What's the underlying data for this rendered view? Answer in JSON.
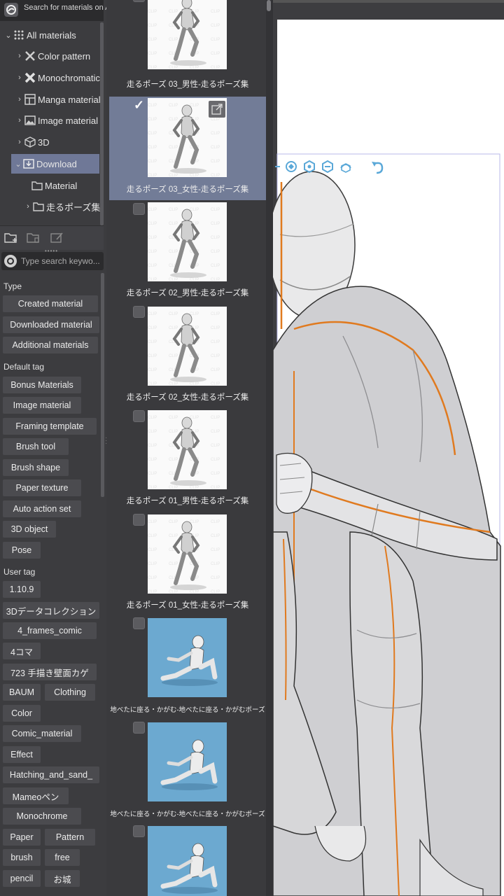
{
  "sidebar": {
    "search_placeholder": "Search for materials on AS",
    "tree": [
      {
        "label": "All materials",
        "expanded": true
      },
      {
        "label": "Color pattern"
      },
      {
        "label": "Monochromatic"
      },
      {
        "label": "Manga material"
      },
      {
        "label": "Image material"
      },
      {
        "label": "3D"
      },
      {
        "label": "Download",
        "selected": true,
        "expanded": true
      },
      {
        "label": "Material"
      },
      {
        "label": "走るポーズ集-"
      }
    ],
    "keyword_placeholder": "Type search keywo...",
    "sections": {
      "type": "Type",
      "default_tag": "Default tag",
      "user_tag": "User tag"
    },
    "type_tags": [
      "Created material",
      "Downloaded material",
      "Additional materials"
    ],
    "default_tags": [
      "Bonus Materials",
      "Image material",
      "Framing template",
      "Brush tool",
      "Brush shape",
      "Paper texture",
      "Auto action set",
      "3D object",
      "Pose"
    ],
    "user_tags": [
      "1.10.9",
      "3Dデータコレクション",
      "4_frames_comic",
      "4コマ",
      "723 手描き壁面カゲ",
      "BAUM",
      "Clothing",
      "Color",
      "Comic_material",
      "Effect",
      "Hatching_and_sand_",
      "Mameoペン",
      "Monochrome",
      "Paper",
      "Pattern",
      "brush",
      "free",
      "pencil",
      "お城"
    ]
  },
  "materials": [
    {
      "caption": "走るポーズ 03_男性-走るポーズ集",
      "checked": false,
      "thumb": "running-figure"
    },
    {
      "caption": "走るポーズ 03_女性-走るポーズ集",
      "checked": true,
      "selected": true,
      "thumb": "running-figure"
    },
    {
      "caption": "走るポーズ 02_男性-走るポーズ集",
      "checked": false,
      "thumb": "running-figure"
    },
    {
      "caption": "走るポーズ 02_女性-走るポーズ集",
      "checked": false,
      "thumb": "running-figure"
    },
    {
      "caption": "走るポーズ 01_男性-走るポーズ集",
      "checked": false,
      "thumb": "running-figure"
    },
    {
      "caption": "走るポーズ 01_女性-走るポーズ集",
      "checked": false,
      "thumb": "running-figure"
    },
    {
      "caption": "地べたに座る・かがむ-地べたに座る・かがむポーズ",
      "checked": false,
      "thumb": "sitting-figure"
    },
    {
      "caption": "地べたに座る・かがむ-地べたに座る・かがむポーズ",
      "checked": false,
      "thumb": "sitting-figure"
    },
    {
      "caption": "",
      "checked": false,
      "thumb": "sitting-figure"
    }
  ],
  "colors": {
    "selection": "#727c97",
    "tree_selection": "#6f7897",
    "accent_3d": "#5aa8d8",
    "model_line": "#e07a1f"
  }
}
